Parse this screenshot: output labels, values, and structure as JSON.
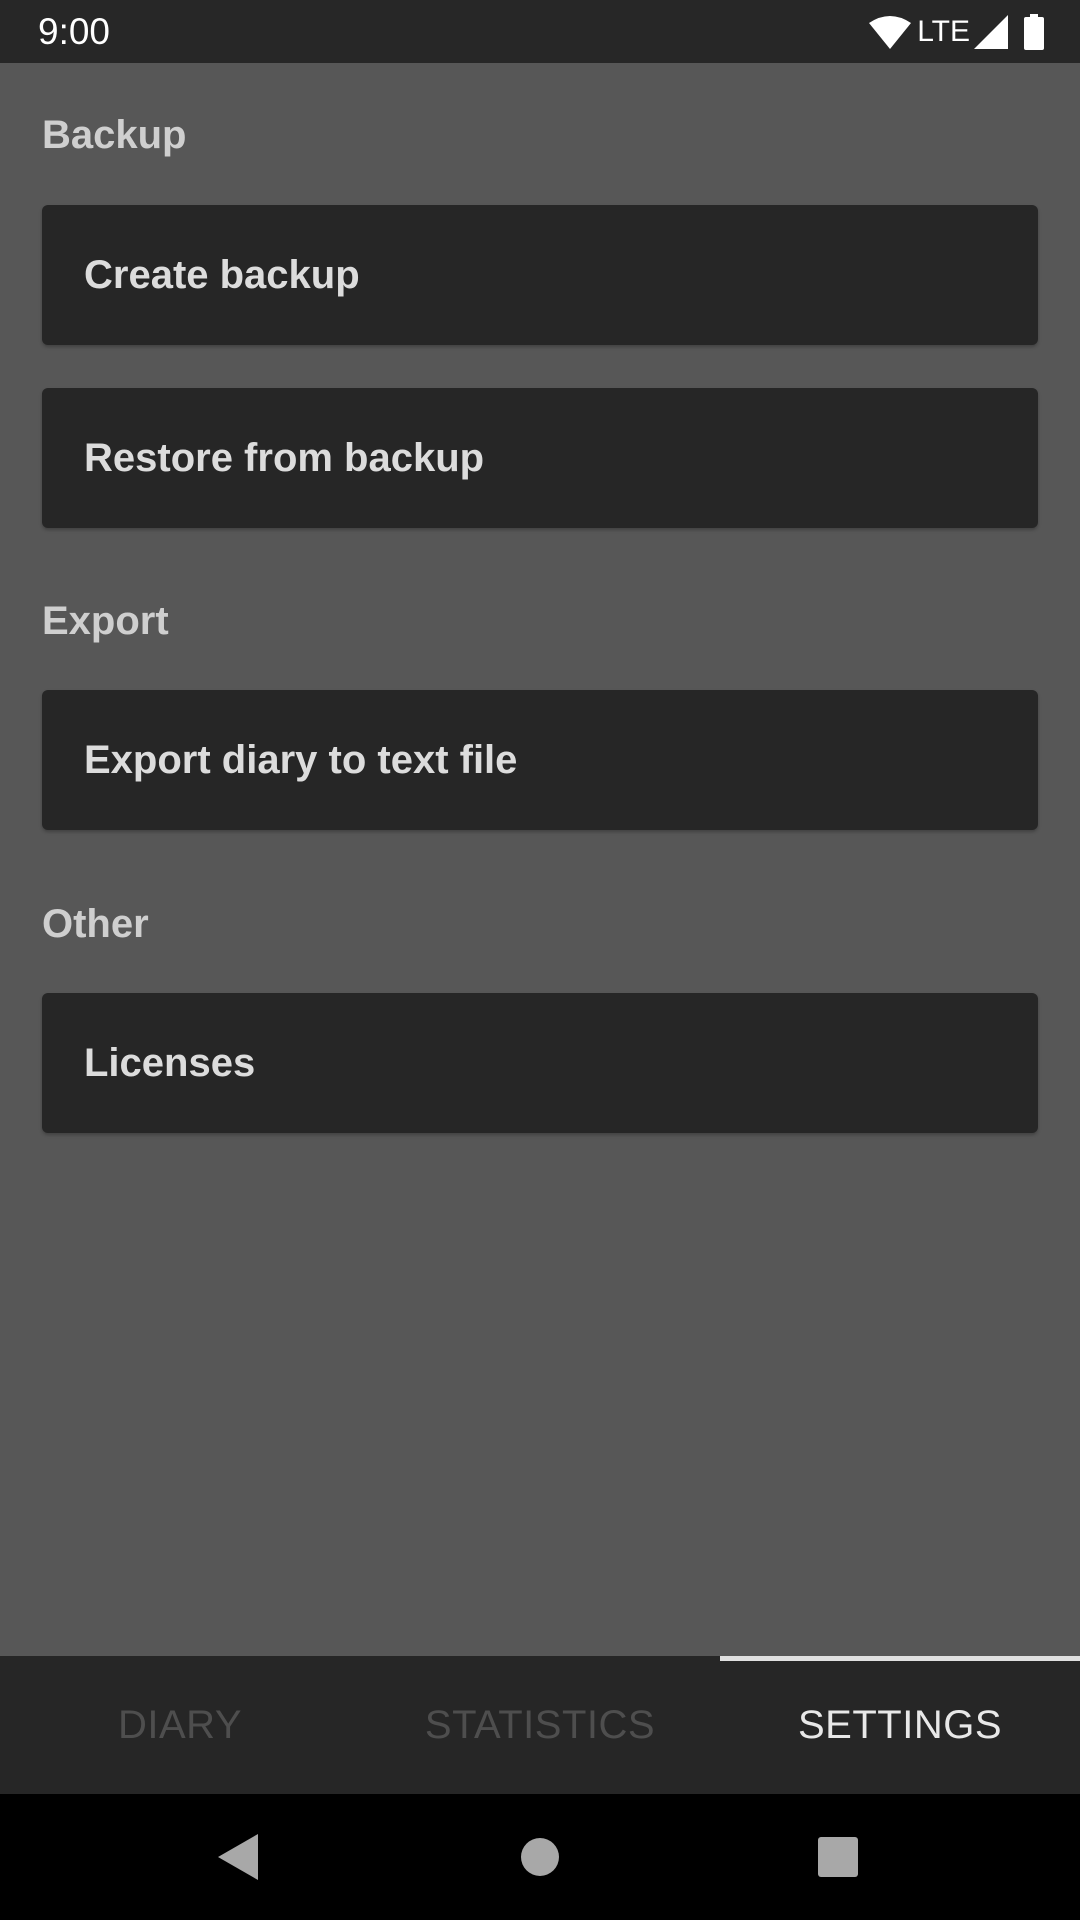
{
  "status_bar": {
    "time": "9:00",
    "network_label": "LTE",
    "icons": [
      "wifi-icon",
      "cell-signal-icon",
      "battery-icon"
    ]
  },
  "sections": [
    {
      "header": "Backup",
      "items": [
        {
          "label": "Create backup"
        },
        {
          "label": "Restore from backup"
        }
      ]
    },
    {
      "header": "Export",
      "items": [
        {
          "label": "Export diary to text file"
        }
      ]
    },
    {
      "header": "Other",
      "items": [
        {
          "label": "Licenses"
        }
      ]
    }
  ],
  "tabs": [
    {
      "label": "DIARY",
      "selected": false
    },
    {
      "label": "STATISTICS",
      "selected": false
    },
    {
      "label": "SETTINGS",
      "selected": true
    }
  ],
  "nav_bar": {
    "icons": [
      "back-icon",
      "home-icon",
      "recents-icon"
    ]
  },
  "colors": {
    "background": "#575757",
    "card": "#262626",
    "bar": "#262626",
    "header_text": "#cfcfcf",
    "active_tab": "#e8e8e8",
    "inactive_tab": "#4e4e4e"
  }
}
